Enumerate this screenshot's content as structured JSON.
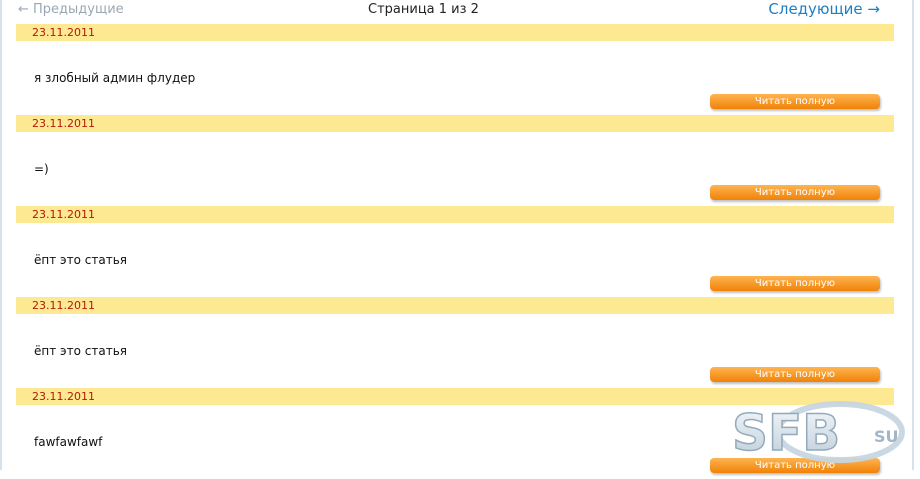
{
  "pager": {
    "prev_label": "← Предыдущие",
    "page_info": "Страница 1 из 2",
    "next_label": "Следующие →"
  },
  "posts": [
    {
      "date": "23.11.2011",
      "text": "я злобный админ флудер",
      "button": "Читать полную"
    },
    {
      "date": "23.11.2011",
      "text": "=)",
      "button": "Читать полную"
    },
    {
      "date": "23.11.2011",
      "text": "ёпт это статья",
      "button": "Читать полную"
    },
    {
      "date": "23.11.2011",
      "text": "ёпт это статья",
      "button": "Читать полную"
    },
    {
      "date": "23.11.2011",
      "text": "fawfawfawf",
      "button": "Читать полную"
    }
  ],
  "watermark": {
    "text": "SFB",
    "suffix": "SU"
  },
  "colors": {
    "date_bar": "#fde992",
    "date_text": "#b5170c",
    "button": "#f08208",
    "link": "#1f7fc4"
  }
}
